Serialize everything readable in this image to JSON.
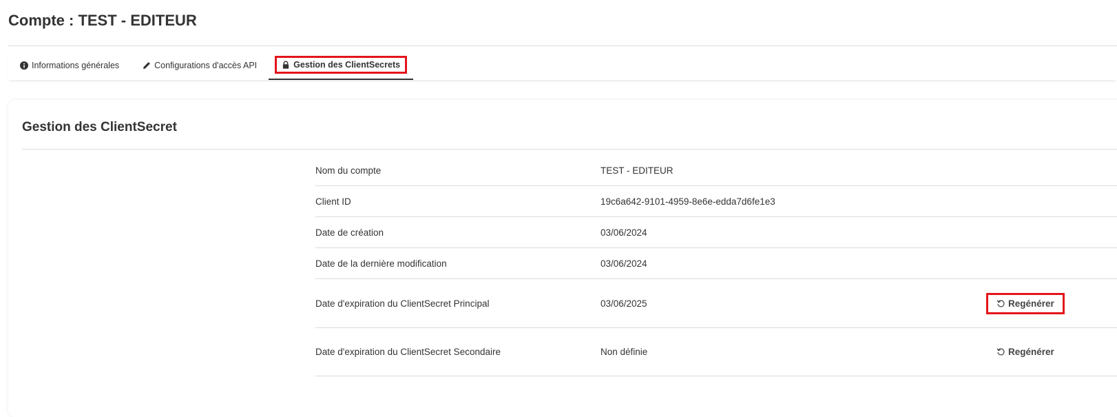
{
  "page": {
    "title": "Compte : TEST - EDITEUR"
  },
  "tabs": [
    {
      "label": "Informations générales",
      "icon": "info-circle-icon",
      "active": false
    },
    {
      "label": "Configurations d'accès API",
      "icon": "pencil-icon",
      "active": false
    },
    {
      "label": "Gestion des ClientSecrets",
      "icon": "lock-icon",
      "active": true
    }
  ],
  "card": {
    "title": "Gestion des ClientSecret"
  },
  "rows": [
    {
      "label": "Nom du compte",
      "value": "TEST - EDITEUR"
    },
    {
      "label": "Client ID",
      "value": "19c6a642-9101-4959-8e6e-edda7d6fe1e3"
    },
    {
      "label": "Date de création",
      "value": "03/06/2024"
    },
    {
      "label": "Date de la dernière modification",
      "value": "03/06/2024"
    },
    {
      "label": "Date d'expiration du ClientSecret Principal",
      "value": "03/06/2025",
      "action": "Regénérer"
    },
    {
      "label": "Date d'expiration du ClientSecret Secondaire",
      "value": "Non définie",
      "action": "Regénérer"
    }
  ],
  "colors": {
    "highlight": "#e3151a",
    "text": "#333333",
    "divider": "#dcdcdc"
  }
}
